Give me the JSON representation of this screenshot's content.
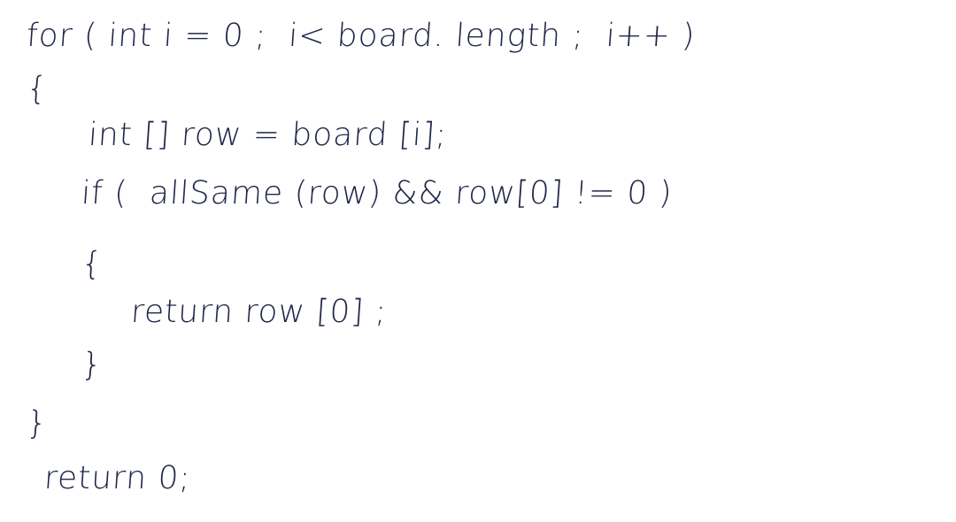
{
  "note": {
    "ink_color": "#1f2547",
    "lines": [
      "for ( int i = 0 ;  i< board. length ;  i++ )",
      "{",
      "int [] row = board [i];",
      "if (  allSame (row) && row[0] != 0 )",
      "{",
      "return row [0] ;",
      "}",
      "}",
      "return 0;"
    ]
  }
}
